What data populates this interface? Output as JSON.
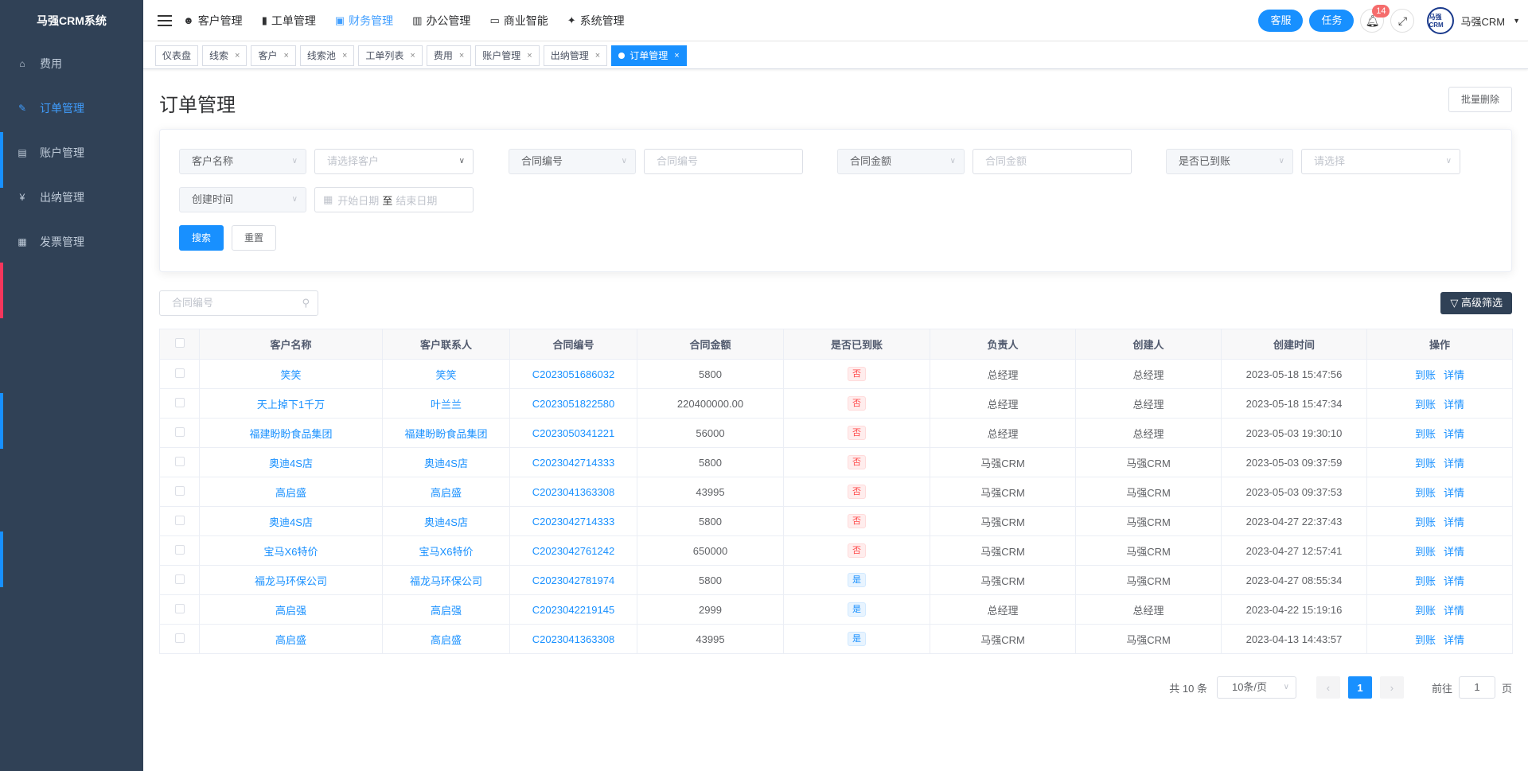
{
  "app": {
    "title": "马强CRM系统"
  },
  "sidebar": {
    "items": [
      {
        "label": "费用",
        "icon": "home-icon"
      },
      {
        "label": "订单管理",
        "icon": "edit-icon"
      },
      {
        "label": "账户管理",
        "icon": "card-icon"
      },
      {
        "label": "出纳管理",
        "icon": "yen-icon"
      },
      {
        "label": "发票管理",
        "icon": "invoice-icon"
      }
    ],
    "active_index": 1
  },
  "topnav": {
    "menu": [
      {
        "label": "客户管理",
        "icon": "user-icon"
      },
      {
        "label": "工单管理",
        "icon": "clipboard-icon"
      },
      {
        "label": "财务管理",
        "icon": "finance-icon"
      },
      {
        "label": "办公管理",
        "icon": "office-icon"
      },
      {
        "label": "商业智能",
        "icon": "bi-icon"
      },
      {
        "label": "系统管理",
        "icon": "wrench-icon"
      }
    ],
    "active_index": 2,
    "service_label": "客服",
    "task_label": "任务",
    "notification_count": "14",
    "avatar_text": "马强CRM",
    "username": "马强CRM"
  },
  "tags": [
    {
      "label": "仪表盘",
      "closable": false
    },
    {
      "label": "线索",
      "closable": true
    },
    {
      "label": "客户",
      "closable": true
    },
    {
      "label": "线索池",
      "closable": true
    },
    {
      "label": "工单列表",
      "closable": true
    },
    {
      "label": "费用",
      "closable": true
    },
    {
      "label": "账户管理",
      "closable": true
    },
    {
      "label": "出纳管理",
      "closable": true
    },
    {
      "label": "订单管理",
      "closable": true,
      "active": true
    }
  ],
  "page": {
    "title": "订单管理",
    "batch_delete": "批量删除"
  },
  "filters": {
    "customer_name": {
      "label": "客户名称",
      "placeholder": "请选择客户"
    },
    "contract_no": {
      "label": "合同编号",
      "placeholder": "合同编号"
    },
    "contract_amount": {
      "label": "合同金额",
      "placeholder": "合同金额"
    },
    "paid": {
      "label": "是否已到账",
      "placeholder": "请选择"
    },
    "created": {
      "label": "创建时间",
      "start": "开始日期",
      "sep": "至",
      "end": "结束日期"
    },
    "search_btn": "搜索",
    "reset_btn": "重置"
  },
  "table_search": {
    "placeholder": "合同编号"
  },
  "advanced_filter": "高级筛选",
  "table": {
    "columns": [
      "客户名称",
      "客户联系人",
      "合同编号",
      "合同金额",
      "是否已到账",
      "负责人",
      "创建人",
      "创建时间",
      "操作"
    ],
    "rows": [
      {
        "customer": "笑笑",
        "contact": "笑笑",
        "contract": "C2023051686032",
        "amount": "5800",
        "paid": "否",
        "owner": "总经理",
        "creator": "总经理",
        "created": "2023-05-18 15:47:56"
      },
      {
        "customer": "天上掉下1千万",
        "contact": "叶兰兰",
        "contract": "C2023051822580",
        "amount": "220400000.00",
        "paid": "否",
        "owner": "总经理",
        "creator": "总经理",
        "created": "2023-05-18 15:47:34"
      },
      {
        "customer": "福建盼盼食品集团",
        "contact": "福建盼盼食品集团",
        "contract": "C2023050341221",
        "amount": "56000",
        "paid": "否",
        "owner": "总经理",
        "creator": "总经理",
        "created": "2023-05-03 19:30:10"
      },
      {
        "customer": "奥迪4S店",
        "contact": "奥迪4S店",
        "contract": "C2023042714333",
        "amount": "5800",
        "paid": "否",
        "owner": "马强CRM",
        "creator": "马强CRM",
        "created": "2023-05-03 09:37:59"
      },
      {
        "customer": "高启盛",
        "contact": "高启盛",
        "contract": "C2023041363308",
        "amount": "43995",
        "paid": "否",
        "owner": "马强CRM",
        "creator": "马强CRM",
        "created": "2023-05-03 09:37:53"
      },
      {
        "customer": "奥迪4S店",
        "contact": "奥迪4S店",
        "contract": "C2023042714333",
        "amount": "5800",
        "paid": "否",
        "owner": "马强CRM",
        "creator": "马强CRM",
        "created": "2023-04-27 22:37:43"
      },
      {
        "customer": "宝马X6特价",
        "contact": "宝马X6特价",
        "contract": "C2023042761242",
        "amount": "650000",
        "paid": "否",
        "owner": "马强CRM",
        "creator": "马强CRM",
        "created": "2023-04-27 12:57:41"
      },
      {
        "customer": "福龙马环保公司",
        "contact": "福龙马环保公司",
        "contract": "C2023042781974",
        "amount": "5800",
        "paid": "是",
        "owner": "马强CRM",
        "creator": "马强CRM",
        "created": "2023-04-27 08:55:34"
      },
      {
        "customer": "高启强",
        "contact": "高启强",
        "contract": "C2023042219145",
        "amount": "2999",
        "paid": "是",
        "owner": "总经理",
        "creator": "总经理",
        "created": "2023-04-22 15:19:16"
      },
      {
        "customer": "高启盛",
        "contact": "高启盛",
        "contract": "C2023041363308",
        "amount": "43995",
        "paid": "是",
        "owner": "马强CRM",
        "creator": "马强CRM",
        "created": "2023-04-13 14:43:57"
      }
    ],
    "actions": [
      "到账",
      "详情"
    ]
  },
  "pagination": {
    "total": "共 10 条",
    "page_size": "10条/页",
    "current": "1",
    "goto_prefix": "前往",
    "goto_value": "1",
    "goto_suffix": "页"
  },
  "colors": {
    "sidebar_bg": "#304156",
    "primary": "#1890ff",
    "danger": "#ff4949",
    "side_mark_red": "#f5365c",
    "side_mark_blue": "#1890ff"
  }
}
